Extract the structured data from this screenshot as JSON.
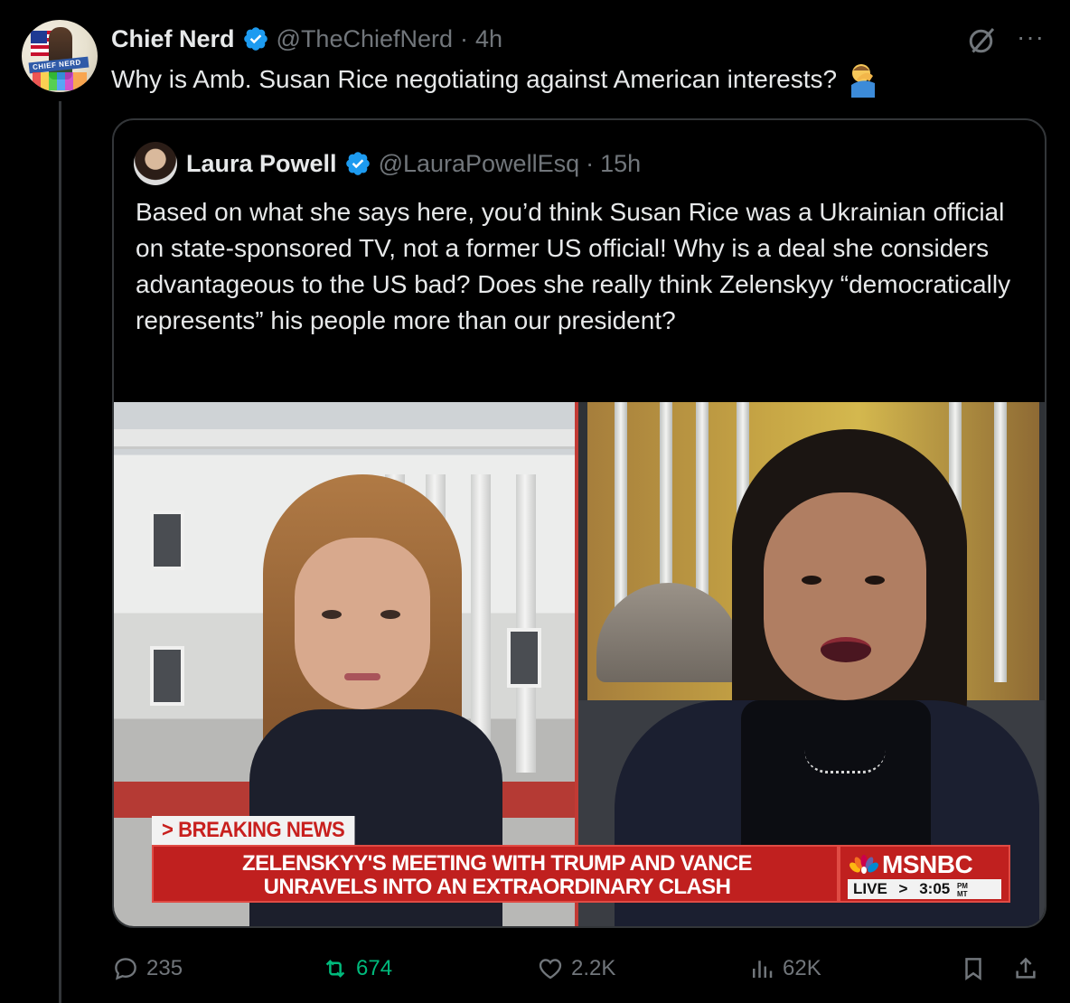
{
  "post": {
    "author_name": "Chief Nerd",
    "author_handle": "@TheChiefNerd",
    "separator": "·",
    "time": "4h",
    "avatar_text": "CHIEF NERD",
    "text": "Why is Amb. Susan Rice negotiating against American interests?",
    "emoji": "🤦‍♂️",
    "more_label": "···"
  },
  "quote": {
    "author_name": "Laura Powell",
    "author_handle": "@LauraPowellEsq",
    "separator": "·",
    "time": "15h",
    "text": "Based on what she says here, you’d think Susan Rice was a Ukrainian official on state-sponsored TV, not a former US official! Why is a deal she considers advantageous to the US bad? Does she really think Zelenskyy “democratically represents” his people more than our president?"
  },
  "video": {
    "breaking_label": "> BREAKING NEWS",
    "headline_line1": "ZELENSKYY'S MEETING WITH TRUMP AND VANCE",
    "headline_line2": "UNRAVELS INTO AN EXTRAORDINARY CLASH",
    "network": "MSNBC",
    "live_label": "LIVE",
    "live_arrow": ">",
    "clock": "3:05",
    "clock_suffix_top": "PM",
    "clock_suffix_bottom": "MT"
  },
  "actions": {
    "replies": "235",
    "reposts": "674",
    "likes": "2.2K",
    "views": "62K"
  },
  "colors": {
    "background": "#000000",
    "text_primary": "#e7e9ea",
    "text_secondary": "#71767b",
    "verified_blue": "#1d9bf0",
    "repost_green": "#00ba7c",
    "msnbc_red": "#c0201f"
  }
}
